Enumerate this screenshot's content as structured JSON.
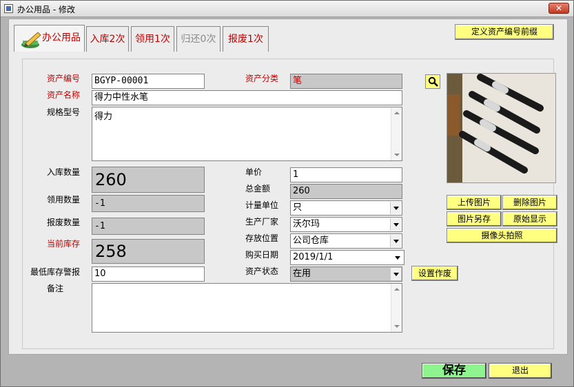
{
  "window": {
    "title": "办公用品 - 修改",
    "close_label": "✕"
  },
  "tabs": [
    {
      "label": "办公用品"
    },
    {
      "label": "入库2次"
    },
    {
      "label": "领用1次"
    },
    {
      "label": "归还0次"
    },
    {
      "label": "报废1次"
    }
  ],
  "prefix_button": "定义资产编号前缀",
  "form": {
    "asset_code": {
      "label": "资产编号",
      "value": "BGYP-00001"
    },
    "asset_name": {
      "label": "资产名称",
      "value": "得力中性水笔"
    },
    "spec_model": {
      "label": "规格型号",
      "value": "得力"
    },
    "asset_category": {
      "label": "资产分类",
      "value": "笔"
    },
    "in_qty": {
      "label": "入库数量",
      "value": "260"
    },
    "use_qty": {
      "label": "领用数量",
      "value": "-1"
    },
    "scrap_qty": {
      "label": "报废数量",
      "value": "-1"
    },
    "current_stock": {
      "label": "当前库存",
      "value": "258"
    },
    "min_stock_alert": {
      "label": "最低库存警报",
      "value": "10"
    },
    "remark": {
      "label": "备注",
      "value": ""
    },
    "unit_price": {
      "label": "单价",
      "value": "1"
    },
    "total_amount": {
      "label": "总金额",
      "value": "260"
    },
    "unit": {
      "label": "计量单位",
      "value": "只"
    },
    "manufacturer": {
      "label": "生产厂家",
      "value": "沃尔玛"
    },
    "location": {
      "label": "存放位置",
      "value": "公司仓库"
    },
    "purchase_date": {
      "label": "购买日期",
      "value": "2019/1/1"
    },
    "asset_status": {
      "label": "资产状态",
      "value": "在用"
    }
  },
  "buttons": {
    "upload_image": "上传图片",
    "delete_image": "删除图片",
    "save_image_as": "图片另存",
    "original_view": "原始显示",
    "camera_photo": "摄像头拍照",
    "set_scrapped": "设置作废",
    "save": "保存",
    "exit": "退出"
  },
  "colors": {
    "label_red": "#c00000",
    "button_yellow": "#ffff80",
    "save_green": "#8ef58e",
    "readonly_gray": "#c8c8c8"
  },
  "icons": [
    "app-icon",
    "close-icon",
    "pencil-icon",
    "search-icon",
    "scroll-up-icon",
    "scroll-down-icon",
    "dropdown-arrow-icon"
  ]
}
